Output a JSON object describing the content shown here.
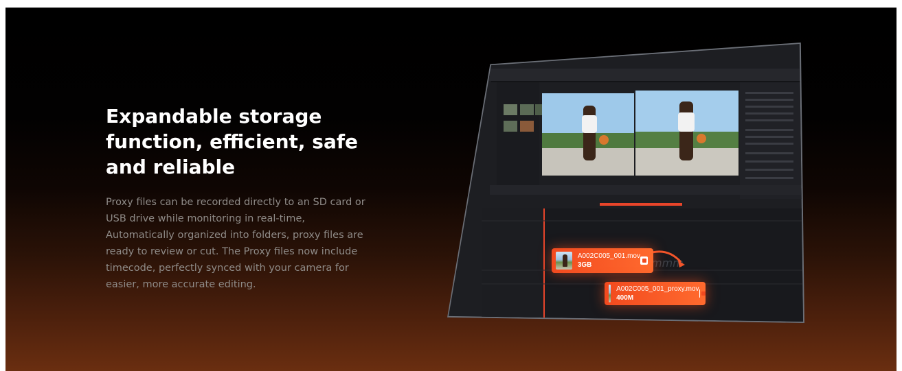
{
  "section": {
    "headline": "Expandable storage function, efficient, safe and reliable",
    "description": "Proxy files can be recorded directly to an SD card or USB drive while monitoring in real-time, Automatically organized into folders, proxy files are ready to review or cut. The Proxy files now include timecode, perfectly synced with your camera for easier, more accurate editing."
  },
  "editor": {
    "original_clip": {
      "name": "A002C005_001.mov",
      "size": "3GB"
    },
    "proxy_clip": {
      "name": "A002C005_001_proxy.mov",
      "size": "400M"
    }
  },
  "colors": {
    "accent": "#f24a1f",
    "background_top": "#000000",
    "background_bottom": "#6a2e10",
    "headline": "#ffffff",
    "body": "#8f8b88"
  },
  "icons": [
    "proxy-badge-icon",
    "convert-arrow-icon"
  ]
}
